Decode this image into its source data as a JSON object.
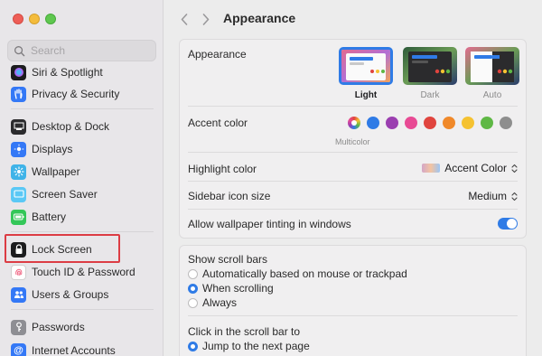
{
  "sidebar": {
    "search_placeholder": "Search",
    "items": [
      {
        "label": "Siri & Spotlight",
        "icon": "siri-icon",
        "color": "#1f1f1f"
      },
      {
        "label": "Privacy & Security",
        "icon": "hand-icon",
        "color": "#3478f6"
      },
      {
        "label": "Desktop & Dock",
        "icon": "dock-icon",
        "color": "#1f1f1f"
      },
      {
        "label": "Displays",
        "icon": "display-icon",
        "color": "#3478f6"
      },
      {
        "label": "Wallpaper",
        "icon": "wallpaper-icon",
        "color": "#3fb3e8"
      },
      {
        "label": "Screen Saver",
        "icon": "screensaver-icon",
        "color": "#5ac8f5"
      },
      {
        "label": "Battery",
        "icon": "battery-icon",
        "color": "#34c759"
      },
      {
        "label": "Lock Screen",
        "icon": "lock-icon",
        "color": "#1f1f1f"
      },
      {
        "label": "Touch ID & Password",
        "icon": "fingerprint-icon",
        "color": "#ffffff"
      },
      {
        "label": "Users & Groups",
        "icon": "users-icon",
        "color": "#3478f6"
      },
      {
        "label": "Passwords",
        "icon": "key-icon",
        "color": "#8e8e93"
      },
      {
        "label": "Internet Accounts",
        "icon": "at-icon",
        "color": "#3478f6"
      }
    ]
  },
  "main": {
    "title": "Appearance",
    "appearance": {
      "label": "Appearance",
      "options": [
        "Light",
        "Dark",
        "Auto"
      ],
      "selected": "Light"
    },
    "accent": {
      "label": "Accent color",
      "selected_name": "Multicolor",
      "colors": [
        "multicolor",
        "#2f7be6",
        "#9b3fb0",
        "#e84a94",
        "#e0443e",
        "#f0892a",
        "#f5c231",
        "#5fb845",
        "#8e8e8e"
      ]
    },
    "highlight": {
      "label": "Highlight color",
      "value": "Accent Color"
    },
    "sidebar_icon": {
      "label": "Sidebar icon size",
      "value": "Medium"
    },
    "tinting": {
      "label": "Allow wallpaper tinting in windows",
      "enabled": true
    },
    "scroll_bars": {
      "label": "Show scroll bars",
      "options": [
        "Automatically based on mouse or trackpad",
        "When scrolling",
        "Always"
      ],
      "selected": "When scrolling"
    },
    "click_scroll": {
      "label": "Click in the scroll bar to",
      "options": [
        "Jump to the next page"
      ],
      "selected": "Jump to the next page"
    }
  }
}
